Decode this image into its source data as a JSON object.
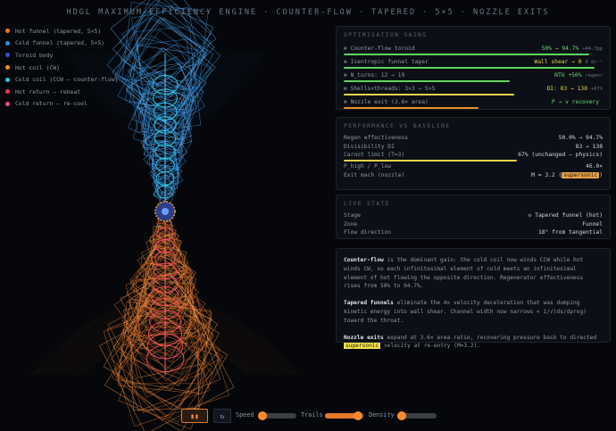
{
  "title": "HDGL MAXIMUM-EFFICIENCY ENGINE · COUNTER-FLOW · TAPERED · 5×5 · NOZZLE EXITS",
  "legend": [
    {
      "label": "Hot funnel (tapered, 5×5)",
      "color": "#f07a2a"
    },
    {
      "label": "Cold funnel (tapered, 5×5)",
      "color": "#2a8fe6"
    },
    {
      "label": "Toroid body",
      "color": "#3b4bd8"
    },
    {
      "label": "Hot coil (CW)",
      "color": "#f0902a"
    },
    {
      "label": "Cold coil (CCW — counter-flow)",
      "color": "#27c6e6"
    },
    {
      "label": "Hot return — reheat",
      "color": "#ef3a4a"
    },
    {
      "label": "Cold return — re-cool",
      "color": "#f24a8a"
    }
  ],
  "gains": {
    "title": "OPTIMISATION GAINS",
    "rows": [
      {
        "label": "⊕ Counter-flow toroid",
        "value": "50% → 94.7%",
        "sub": "+44.7pp",
        "fill": 0.947,
        "color": "#5fd35f"
      },
      {
        "label": "⊕ Isentropic funnel taper",
        "value": "Wall shear → 0",
        "sub": "0 dr⁻¹",
        "fill": 0.97,
        "color": "#5fd35f"
      },
      {
        "label": "⊕ N_turns: 12 → 19",
        "value": "NTU +50%",
        "sub": "regen↑",
        "fill": 0.64,
        "color": "#5fd35f"
      },
      {
        "label": "⊕ Shells×threads: 3×3 → 5×5",
        "value": "DI: 83 → 138",
        "sub": "+67%",
        "fill": 0.66,
        "color": "#e9d24a"
      },
      {
        "label": "⊕ Nozzle exit (3.6× area)",
        "value": "P → v recovery",
        "sub": "",
        "fill": 0.52,
        "color": "#e8902a"
      }
    ]
  },
  "performance": {
    "title": "PERFORMANCE VS BASELINE",
    "regen_label": "Regen effectiveness",
    "regen_value": "50.0% → 94.7%",
    "div_label": "Divisibility DI",
    "div_value": "83 → 138",
    "carnot_label": "Carnot limit (T=3)",
    "carnot_value": "67% (unchanged — physics)",
    "carnot_fill": 0.67,
    "ratio_label": "P_high / P_low",
    "ratio_value": "46.0×",
    "mach_label": "Exit mach (nozzle)",
    "mach_value": "M ≈ 3.2 (",
    "mach_tag": "supersonic",
    "mach_close": ")"
  },
  "live": {
    "title": "LIVE STATE",
    "stage_label": "Stage",
    "stage_value": "◇ Tapered funnel (hot)",
    "zone_label": "Zone",
    "zone_value": "Funnel",
    "flow_label": "Flow direction",
    "flow_value": "18° from tangential"
  },
  "desc": {
    "p1_b": "Counter-flow",
    "p1": " is the dominant gain: the cold coil now winds CCW while hot winds CW, so each infinitesimal element of cold meets an infinitesimal element of hot flowing the opposite direction. Regenerator effectiveness rises from 50% to 94.7%.",
    "p2_b": "Tapered funnels",
    "p2": " eliminate the 4× velocity deceleration that was dumping kinetic energy into wall shear. Channel width now narrows ∝ 1/√(ds/dρrog) toward the throat.",
    "p3_b": "Nozzle exits",
    "p3": " expand at 3.6× area ratio, recovering pressure back to directed ",
    "p3_tag": "supersonic",
    "p3_end": " velocity at re-entry (M≈3.2)."
  },
  "controls": {
    "play_icon": "▮▮",
    "reset_icon": "↻",
    "speed_label": "Speed",
    "speed": 0.1,
    "trails_label": "Trails",
    "trails": 0.85,
    "density_label": "Density",
    "density": 0.12
  }
}
